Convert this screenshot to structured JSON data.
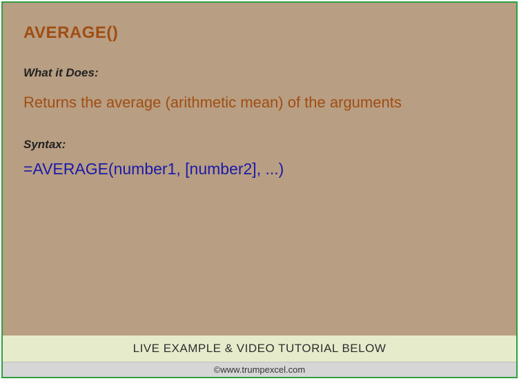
{
  "function": {
    "title": "AVERAGE()",
    "what_it_does_label": "What it Does:",
    "description": "Returns the average (arithmetic mean) of the arguments",
    "syntax_label": "Syntax:",
    "syntax_value": "=AVERAGE(number1, [number2], ...)"
  },
  "banner": "LIVE EXAMPLE & VIDEO TUTORIAL BELOW",
  "credit": "©www.trumpexcel.com"
}
